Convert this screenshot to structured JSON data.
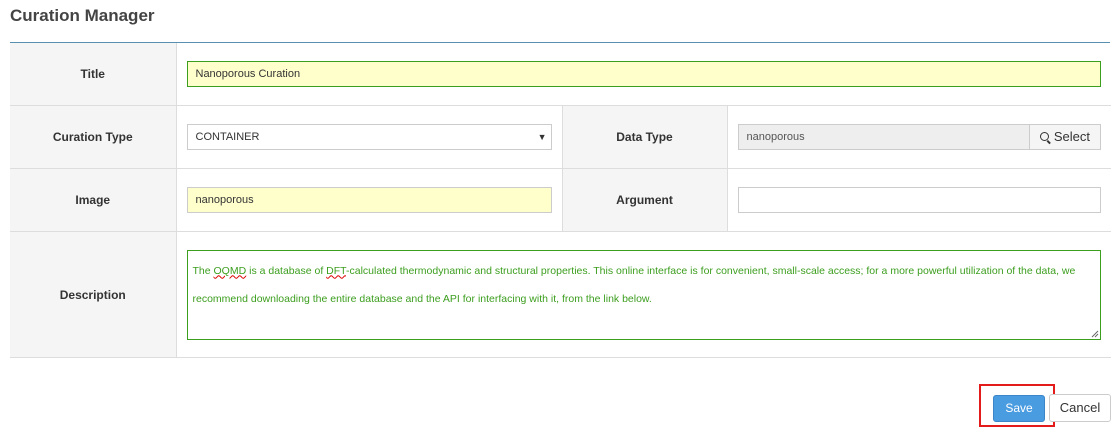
{
  "page": {
    "title": "Curation Manager"
  },
  "form": {
    "title": {
      "label": "Title",
      "value": "Nanoporous Curation"
    },
    "curation_type": {
      "label": "Curation Type",
      "value": "CONTAINER"
    },
    "data_type": {
      "label": "Data Type",
      "value": "nanoporous",
      "button_label": "Select",
      "button_icon": "search-icon"
    },
    "image": {
      "label": "Image",
      "value": "nanoporous"
    },
    "argument": {
      "label": "Argument",
      "value": ""
    },
    "description": {
      "label": "Description",
      "value_parts": [
        "The ",
        "OQMD",
        " is a database of ",
        "DFT",
        "-calculated thermodynamic and structural properties. This online interface is for convenient, small-scale access; for a more powerful utilization of the data, we recommend downloading the entire database and the API for interfacing with it, from the link below."
      ]
    }
  },
  "actions": {
    "save_label": "Save",
    "cancel_label": "Cancel"
  },
  "colors": {
    "accent": "#4a9ce0",
    "valid_border": "#3c9e1e",
    "required_bg": "#ffffcc",
    "highlight_frame": "#e31b1b",
    "header_rule": "#5b8fb0"
  }
}
